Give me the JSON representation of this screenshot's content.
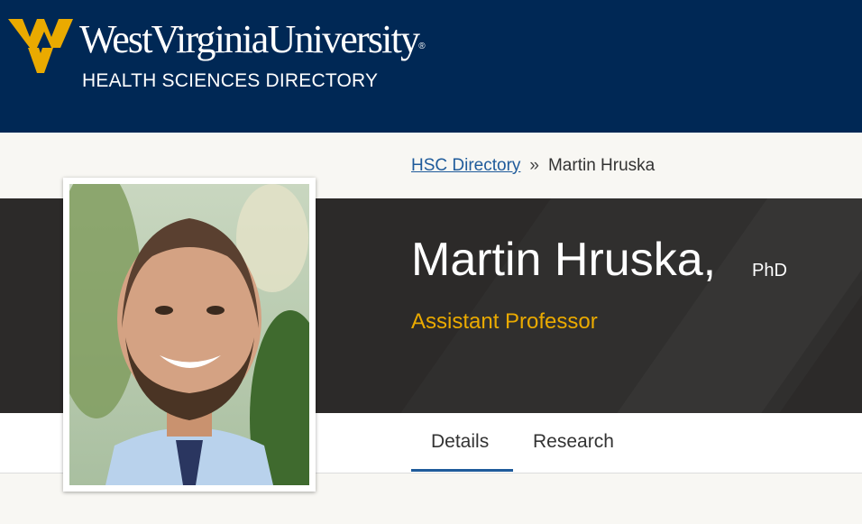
{
  "header": {
    "wordmark": "WestVirginiaUniversity",
    "trademark": "®",
    "subtitle": "HEALTH SCIENCES DIRECTORY",
    "colors": {
      "navy": "#002855",
      "gold": "#eaaa00"
    }
  },
  "breadcrumb": {
    "link": "HSC Directory",
    "separator": "»",
    "current": "Martin Hruska"
  },
  "profile": {
    "name": "Martin Hruska,",
    "degree": "PhD",
    "title": "Assistant Professor",
    "photo_icon": "portrait-photo"
  },
  "tabs": [
    {
      "label": "Details",
      "active": true
    },
    {
      "label": "Research",
      "active": false
    }
  ]
}
